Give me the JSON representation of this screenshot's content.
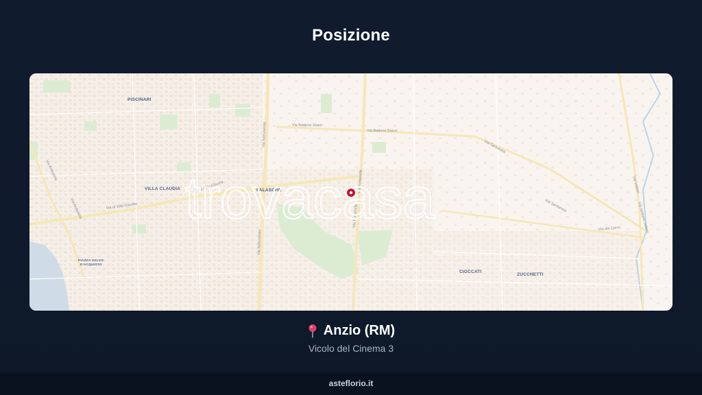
{
  "header": {
    "title": "Posizione"
  },
  "map": {
    "watermark": "trovacasa",
    "place_labels": [
      "PISCINARI",
      "VILLA CLAUDIA",
      "FALASCHE",
      "CIOCCATI",
      "ZUCCHETTI",
      "PIAZZA SALVO",
      "D'ACQUISTO"
    ],
    "street_labels": [
      "Via Batteria Siacci",
      "Via Batteria Siacci",
      "Via Nettunense",
      "Via Ardeatina",
      "Via Ardeatina",
      "Via di Villa Claudia",
      "Via di Villa Claudia",
      "Via Nettunense",
      "Via Santarosa",
      "Via Santarosa",
      "Via del Cerro",
      "Via Velletri",
      "Via Nettuno Velletri",
      "Via Fontanelle",
      "Via Fontanelle"
    ],
    "marker_icon": "location-marker-icon",
    "marker_color": "#c8102e"
  },
  "location": {
    "pin_icon": "pushpin-icon",
    "city": "Anzio (RM)",
    "street": "Vicolo del Cinema 3"
  },
  "footer": {
    "site": "asteflorio.it"
  }
}
